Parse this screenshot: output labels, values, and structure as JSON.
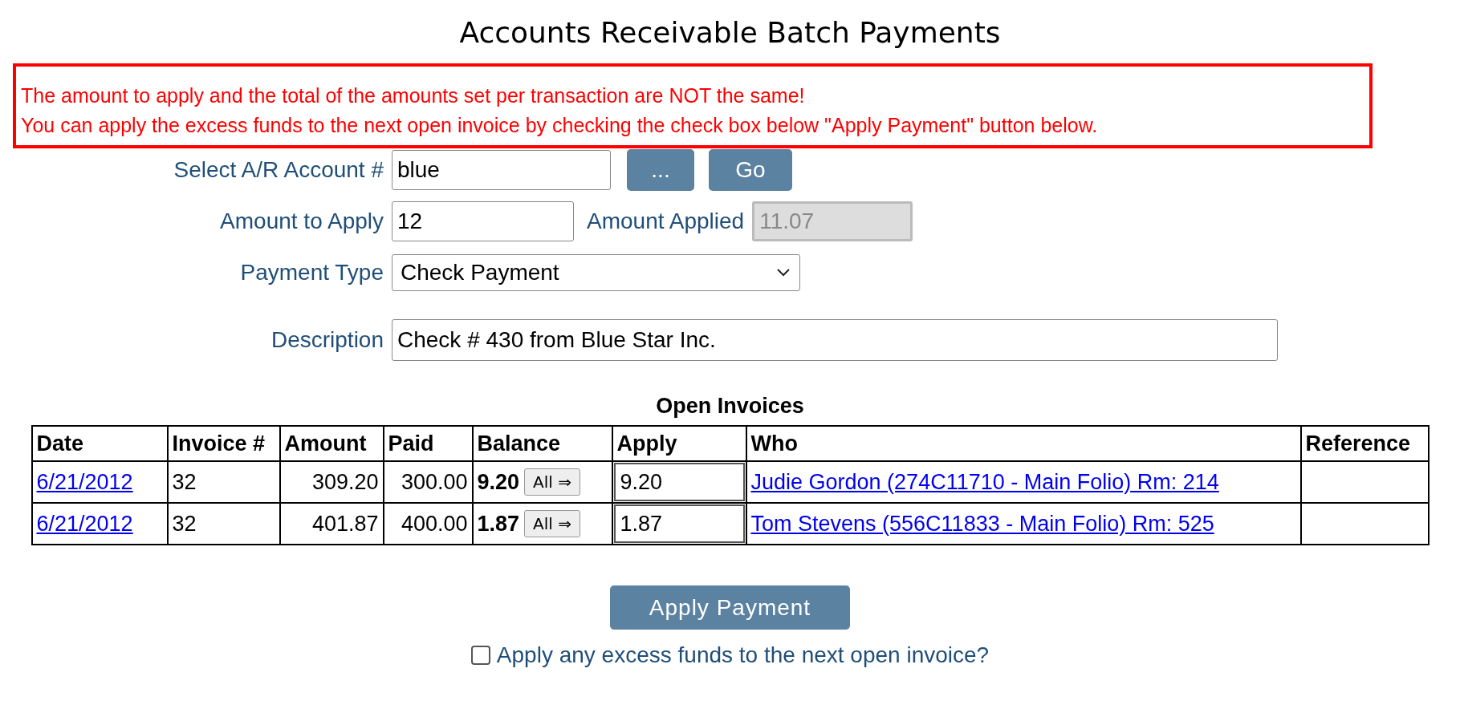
{
  "title": "Accounts Receivable Batch Payments",
  "alert": {
    "lines": [
      "The amount to apply and the total of the amounts set per transaction are NOT the same!",
      "You can apply the excess funds to the next open invoice by checking the check box below \"Apply Payment\" button below."
    ]
  },
  "form": {
    "account": {
      "label": "Select A/R Account #",
      "value": "blue"
    },
    "browse_button": "...",
    "go_button": "Go",
    "amount_to_apply": {
      "label": "Amount to Apply",
      "value": "12"
    },
    "amount_applied": {
      "label": "Amount Applied",
      "value": "11.07",
      "disabled": true
    },
    "payment_type": {
      "label": "Payment Type",
      "value": "Check Payment"
    },
    "description": {
      "label": "Description",
      "value": "Check # 430 from Blue Star Inc."
    }
  },
  "invoices": {
    "title": "Open Invoices",
    "columns": [
      "Date",
      "Invoice #",
      "Amount",
      "Paid",
      "Balance",
      "Apply",
      "Who",
      "Reference"
    ],
    "rows": [
      {
        "date": "6/21/2012",
        "invoice": "32",
        "amount": "309.20",
        "paid": "300.00",
        "balance": "9.20",
        "all_button": "All ⇒",
        "apply": "9.20",
        "who": "Judie Gordon (274C11710 - Main Folio) Rm: 214"
      },
      {
        "date": "6/21/2012",
        "invoice": "32",
        "amount": "401.87",
        "paid": "400.00",
        "balance": "1.87",
        "all_button": "All ⇒",
        "apply": "1.87",
        "who": "Tom Stevens (556C11833 - Main Folio) Rm: 525"
      }
    ]
  },
  "apply_button": "Apply Payment",
  "excess_checkbox": {
    "label": "Apply any excess funds to the next open invoice?",
    "checked": false
  }
}
